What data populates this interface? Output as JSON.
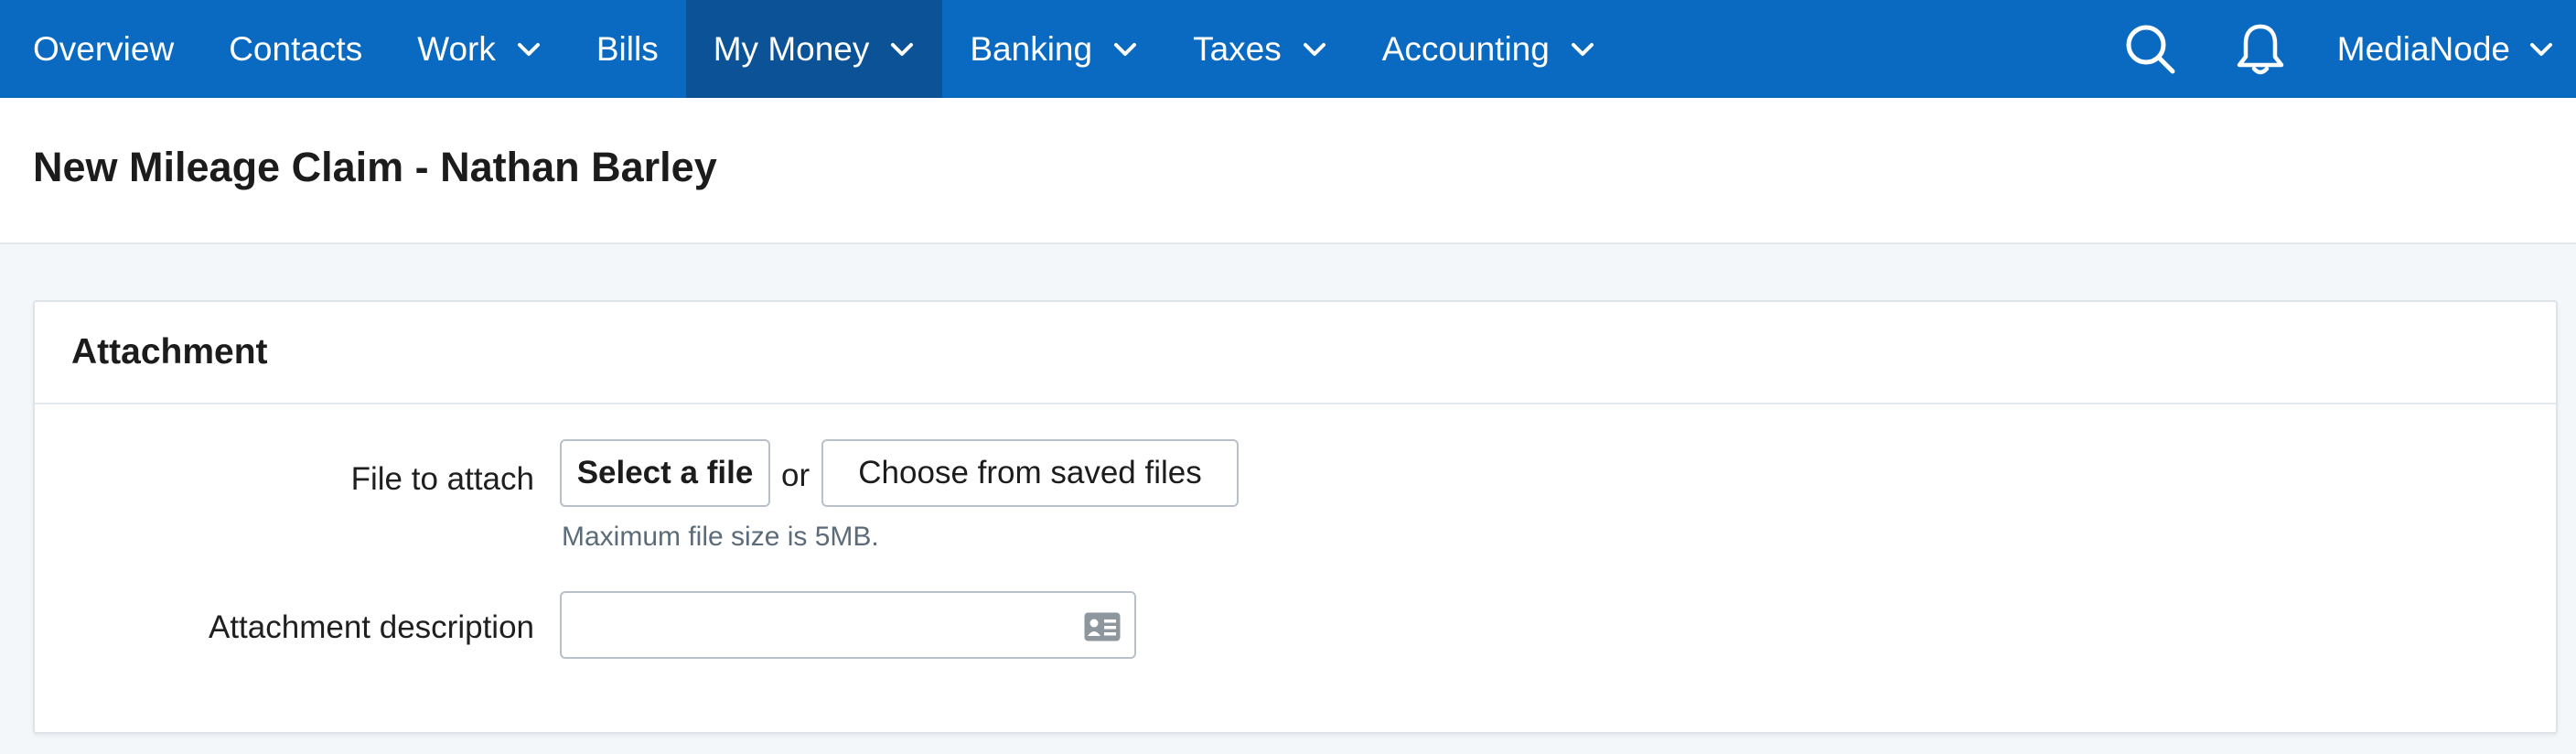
{
  "nav": {
    "items": [
      {
        "label": "Overview",
        "dropdown": false,
        "active": false
      },
      {
        "label": "Contacts",
        "dropdown": false,
        "active": false
      },
      {
        "label": "Work",
        "dropdown": true,
        "active": false
      },
      {
        "label": "Bills",
        "dropdown": false,
        "active": false
      },
      {
        "label": "My Money",
        "dropdown": true,
        "active": true
      },
      {
        "label": "Banking",
        "dropdown": true,
        "active": false
      },
      {
        "label": "Taxes",
        "dropdown": true,
        "active": false
      },
      {
        "label": "Accounting",
        "dropdown": true,
        "active": false
      }
    ],
    "search_icon": "search-icon",
    "notifications_icon": "bell-icon",
    "account_label": "MediaNode"
  },
  "page": {
    "title": "New Mileage Claim - Nathan Barley"
  },
  "attachment": {
    "section_title": "Attachment",
    "file_label": "File to attach",
    "select_file_button": "Select a file",
    "or_text": "or",
    "saved_files_button": "Choose from saved files",
    "file_size_hint": "Maximum file size is 5MB.",
    "description_label": "Attachment description",
    "description_value": "",
    "description_placeholder": ""
  },
  "colors": {
    "nav_background": "#0a6ac2",
    "nav_active": "#0b5396",
    "page_background": "#f4f7fa"
  }
}
